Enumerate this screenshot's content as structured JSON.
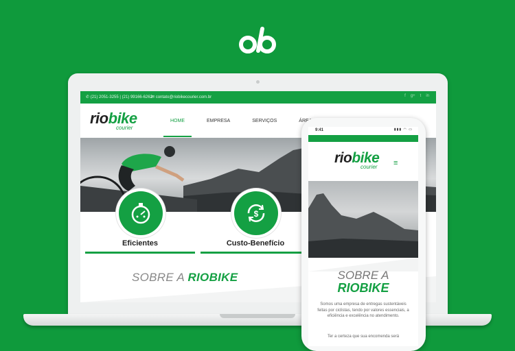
{
  "brand": {
    "monogram": "ob",
    "icon": "ob-logo-icon"
  },
  "laptop": {
    "topbar": {
      "phones": "(21) 2051-3255 | (21) 99166-6262",
      "email": "contato@riobikecourier.com.br",
      "social_icons": [
        "facebook-icon",
        "google-plus-icon",
        "twitter-icon",
        "linkedin-icon"
      ]
    },
    "logo": {
      "word_part1": "rio",
      "word_part2": "bike",
      "sub": "courier"
    },
    "menu": [
      "HOME",
      "EMPRESA",
      "SERVIÇOS",
      "ÁREA DE ATUAÇ"
    ],
    "features": [
      {
        "title": "Eficientes",
        "icon": "stopwatch-icon"
      },
      {
        "title": "Custo-Benefício",
        "icon": "money-exchange-icon"
      }
    ],
    "sobre": {
      "prefix": "SOBRE A ",
      "highlight": "RIOBIKE"
    }
  },
  "phone": {
    "time": "9:41",
    "logo": {
      "word_part1": "rio",
      "word_part2": "bike",
      "sub": "courier"
    },
    "menu_icon": "hamburger-icon",
    "sobre": {
      "line1": "SOBRE A",
      "line2": "RIOBIKE"
    },
    "text1": "Somos uma empresa de entregas sustentáveis feitas por ciclistas, tendo por valores essenciais, a eficiência e excelência no atendimento.",
    "text2": "Ter a certeza que sua encomenda será"
  },
  "colors": {
    "brand_green": "#14a043",
    "background": "#0f9a3c"
  }
}
